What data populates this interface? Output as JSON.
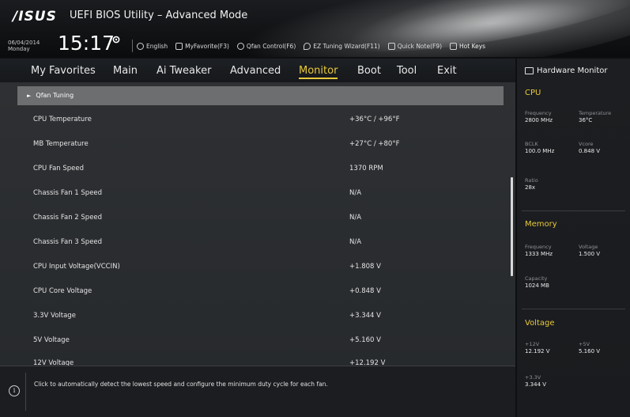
{
  "header": {
    "logo": "/ISUS",
    "title": "UEFI BIOS Utility – Advanced Mode",
    "date": "06/04/2014",
    "day": "Monday",
    "time": "15:17",
    "toolbar": [
      {
        "label": "English",
        "icon": "globe-icon"
      },
      {
        "label": "MyFavorite(F3)",
        "icon": "favorite-icon"
      },
      {
        "label": "Qfan Control(F6)",
        "icon": "fan-icon"
      },
      {
        "label": "EZ Tuning Wizard(F11)",
        "icon": "wizard-icon"
      },
      {
        "label": "Quick Note(F9)",
        "icon": "note-icon"
      },
      {
        "label": "Hot Keys",
        "icon": "keyboard-icon"
      }
    ]
  },
  "nav": {
    "tabs": [
      {
        "label": "My Favorites"
      },
      {
        "label": "Main"
      },
      {
        "label": "Ai Tweaker"
      },
      {
        "label": "Advanced"
      },
      {
        "label": "Monitor",
        "active": true
      },
      {
        "label": "Boot"
      },
      {
        "label": "Tool"
      },
      {
        "label": "Exit"
      }
    ]
  },
  "main": {
    "subheader": "Qfan Tuning",
    "rows": [
      {
        "label": "CPU Temperature",
        "value": "+36°C / +96°F"
      },
      {
        "label": "MB Temperature",
        "value": "+27°C / +80°F"
      },
      {
        "label": "CPU Fan Speed",
        "value": "1370 RPM"
      },
      {
        "label": "Chassis Fan 1 Speed",
        "value": "N/A"
      },
      {
        "label": "Chassis Fan 2 Speed",
        "value": "N/A"
      },
      {
        "label": "Chassis Fan 3 Speed",
        "value": "N/A"
      },
      {
        "label": "CPU Input Voltage(VCCIN)",
        "value": "+1.808 V"
      },
      {
        "label": "CPU Core Voltage",
        "value": "+0.848 V"
      },
      {
        "label": "3.3V Voltage",
        "value": "+3.344 V"
      },
      {
        "label": "5V Voltage",
        "value": "+5.160 V"
      },
      {
        "label": "12V Voltage",
        "value": "+12.192 V"
      }
    ]
  },
  "help": {
    "text": "Click to automatically detect the lowest speed and configure the minimum duty cycle for each fan."
  },
  "hw_monitor": {
    "title": "Hardware Monitor",
    "cpu": {
      "heading": "CPU",
      "frequency_label": "Frequency",
      "frequency": "2800 MHz",
      "temperature_label": "Temperature",
      "temperature": "36°C",
      "bclk_label": "BCLK",
      "bclk": "100.0 MHz",
      "vcore_label": "Vcore",
      "vcore": "0.848 V",
      "ratio_label": "Ratio",
      "ratio": "28x"
    },
    "memory": {
      "heading": "Memory",
      "frequency_label": "Frequency",
      "frequency": "1333 MHz",
      "voltage_label": "Voltage",
      "voltage": "1.500 V",
      "capacity_label": "Capacity",
      "capacity": "1024 MB"
    },
    "voltage": {
      "heading": "Voltage",
      "v12_label": "+12V",
      "v12": "12.192 V",
      "v5_label": "+5V",
      "v5": "5.160 V",
      "v33_label": "+3.3V",
      "v33": "3.344 V"
    }
  },
  "colors": {
    "accent": "#e8c93a",
    "panel": "#2e3033",
    "subheader": "#6c6e70"
  }
}
